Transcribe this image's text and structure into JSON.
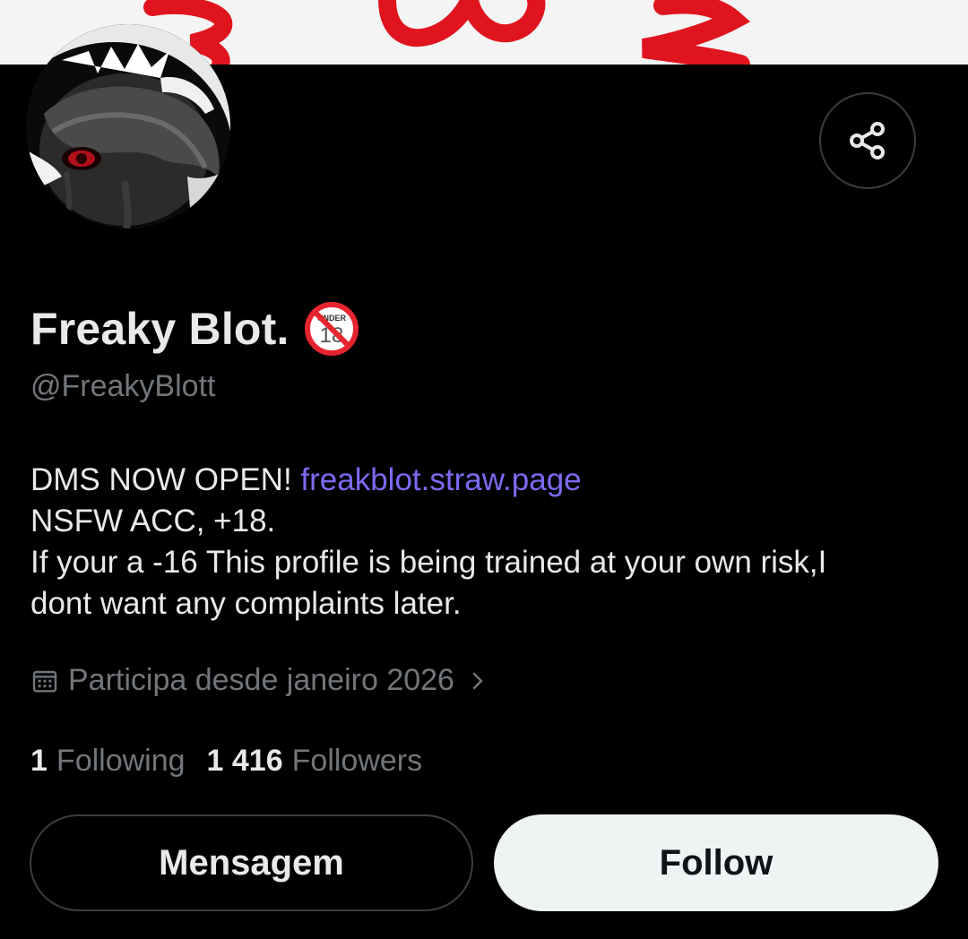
{
  "profile": {
    "display_name": "Freaky Blot.",
    "badge_icon": "no-under-18-icon",
    "badge_text": "UNDER",
    "badge_number": "18",
    "handle": "@FreakyBlott"
  },
  "bio": {
    "line1_text": "DMS NOW OPEN! ",
    "line1_link": "freakblot.straw.page",
    "line2": "NSFW ACC, +18.",
    "line3": "If your a -16 This profile is being trained at your own risk,I",
    "line4": "dont want any complaints later."
  },
  "joined": {
    "icon": "calendar-icon",
    "text": "Participa desde janeiro 2026",
    "chevron_icon": "chevron-right-icon"
  },
  "stats": {
    "following_count": "1",
    "following_label": "Following",
    "followers_count": "1 416",
    "followers_label": "Followers"
  },
  "actions": {
    "share_icon": "share-icon",
    "message_label": "Mensagem",
    "follow_label": "Follow"
  },
  "colors": {
    "background": "#000000",
    "text_primary": "#e7e9ea",
    "text_secondary": "#71767b",
    "link": "#7b6bf2",
    "follow_button_bg": "#eff3f4",
    "banner_red": "#e0141e"
  }
}
